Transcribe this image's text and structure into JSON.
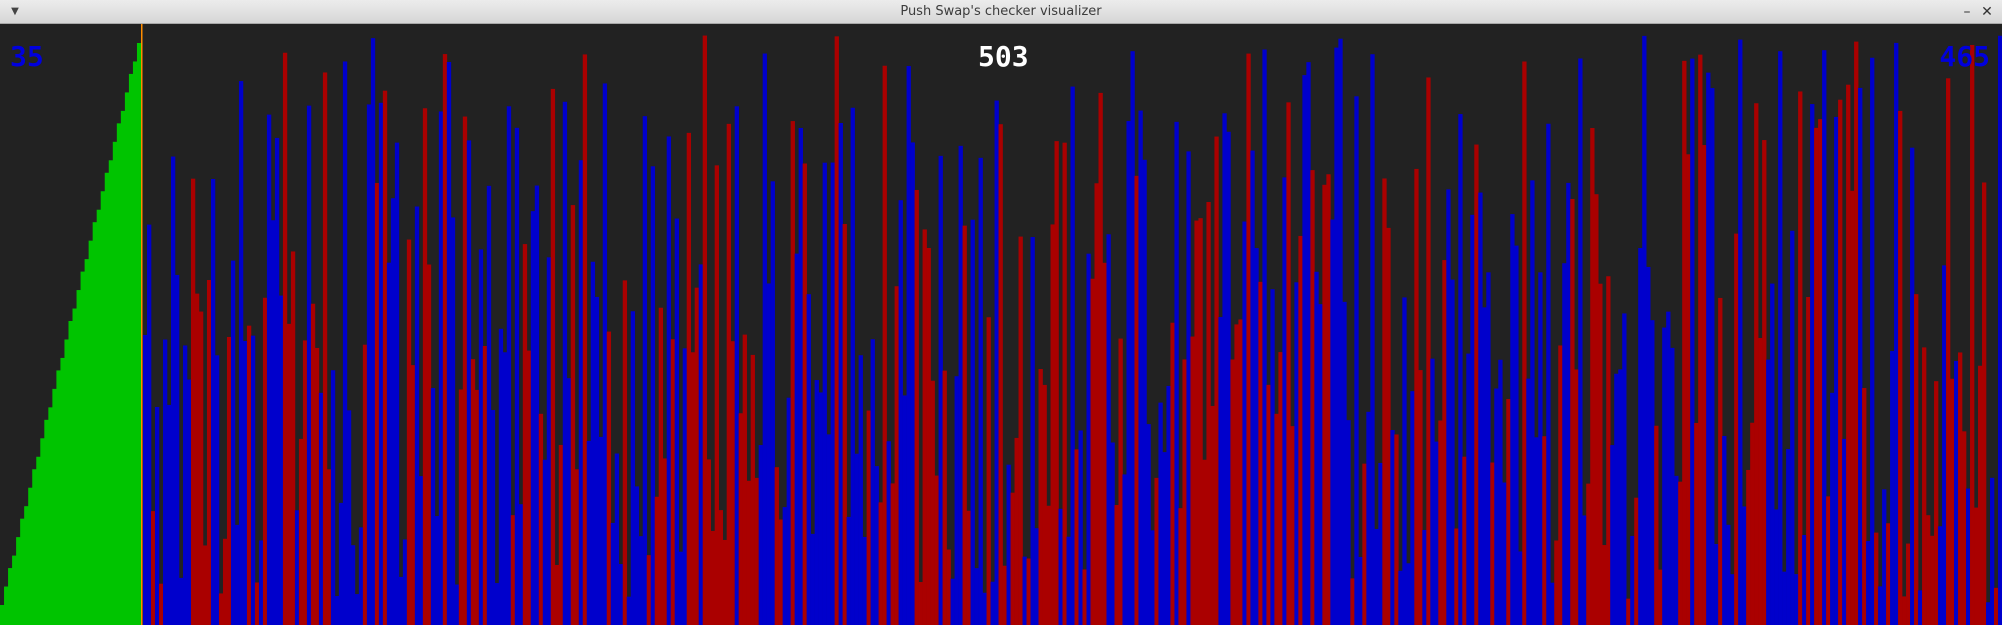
{
  "window": {
    "title": "Push Swap's checker visualizer",
    "menu_icon": "triangle-down-icon",
    "minimize_icon": "minimize-icon",
    "close_icon": "close-icon"
  },
  "colors": {
    "background": "#222222",
    "stack_a": "#00c400",
    "stack_b": "#0000cc",
    "stack_b_highlight": "#aa0000",
    "divider": "#ff8c00",
    "ops_counter": "#ffffff",
    "stack_counters": "#0000dd"
  },
  "counters": {
    "stack_a_count": "35",
    "operations": "503",
    "stack_b_count": "465"
  }
}
